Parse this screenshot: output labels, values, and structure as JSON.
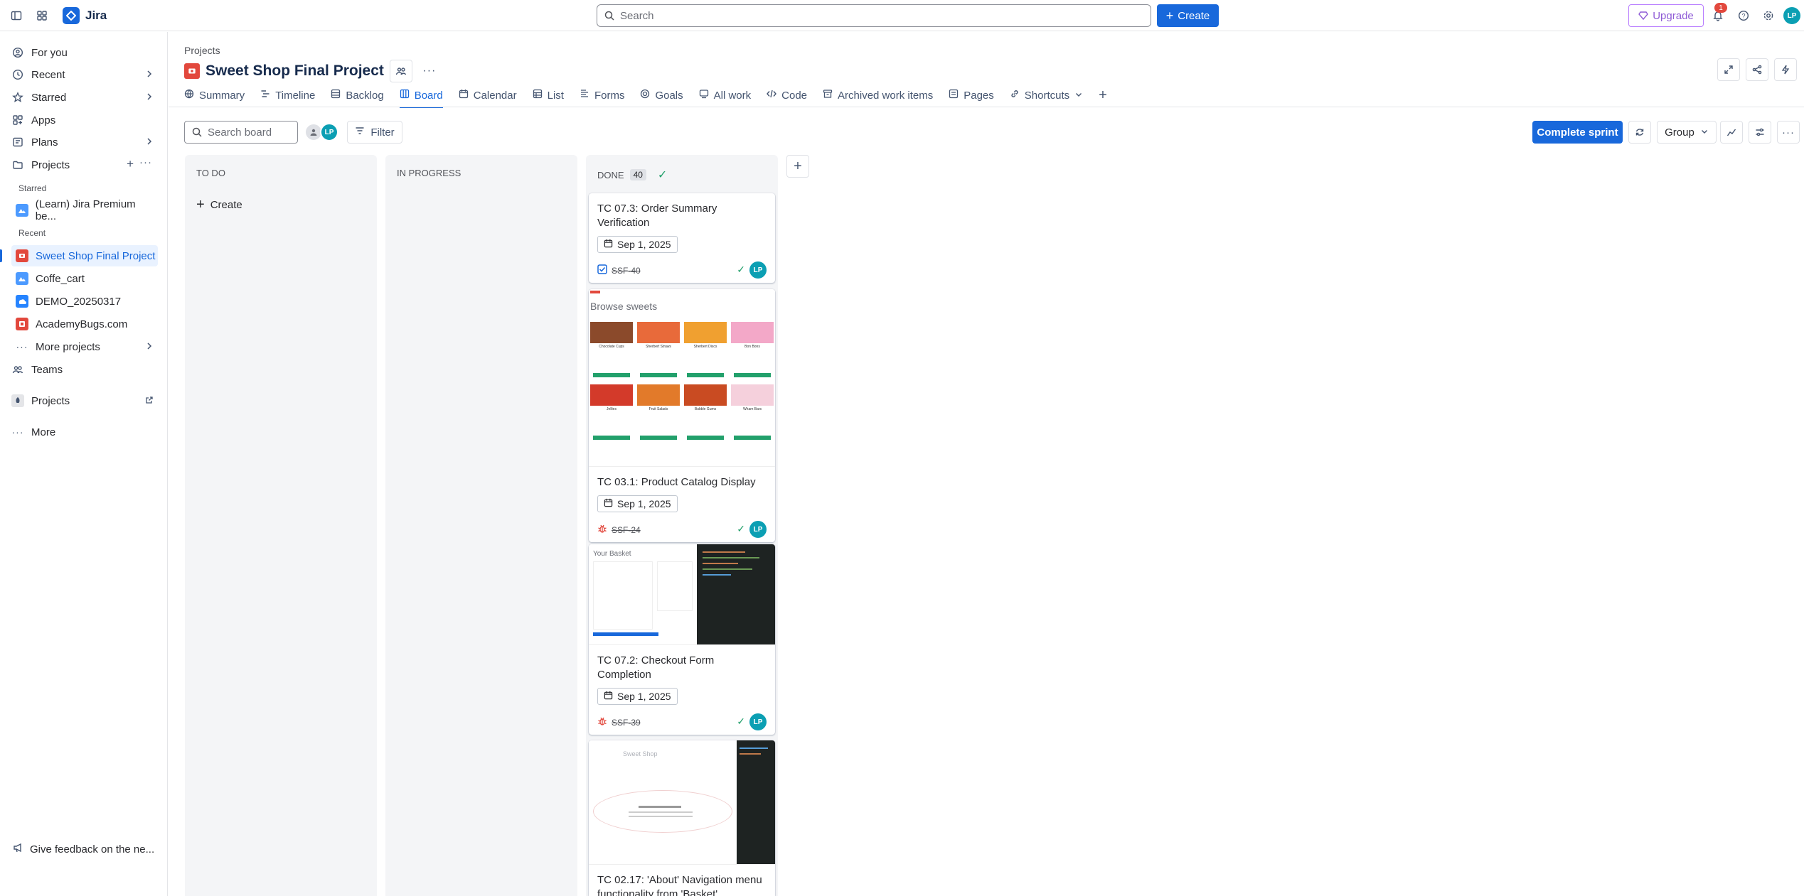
{
  "app": {
    "name": "Jira"
  },
  "topbar": {
    "search_placeholder": "Search",
    "create_label": "Create",
    "upgrade_label": "Upgrade",
    "notifications_count": "1",
    "user_initials": "LP"
  },
  "sidebar": {
    "for_you": "For you",
    "recent": "Recent",
    "starred": "Starred",
    "apps": "Apps",
    "plans": "Plans",
    "projects": "Projects",
    "starred_section": "Starred",
    "starred_project": "(Learn) Jira Premium be...",
    "recent_section": "Recent",
    "recent_projects": [
      "Sweet Shop Final Project",
      "Coffe_cart",
      "DEMO_20250317",
      "AcademyBugs.com"
    ],
    "more_projects": "More projects",
    "teams": "Teams",
    "projects_app": "Projects",
    "more": "More",
    "feedback": "Give feedback on the ne..."
  },
  "breadcrumb": "Projects",
  "project_title": "Sweet Shop Final Project",
  "tabs": [
    "Summary",
    "Timeline",
    "Backlog",
    "Board",
    "Calendar",
    "List",
    "Forms",
    "Goals",
    "All work",
    "Code",
    "Archived work items",
    "Pages",
    "Shortcuts"
  ],
  "active_tab": "Board",
  "toolbar": {
    "search_placeholder": "Search board",
    "filter_label": "Filter",
    "complete_sprint_label": "Complete sprint",
    "group_label": "Group",
    "avatar_initials": "LP"
  },
  "columns": {
    "todo": {
      "title": "TO DO",
      "create_label": "Create"
    },
    "in_progress": {
      "title": "IN PROGRESS"
    },
    "done": {
      "title": "DONE",
      "count": "40"
    }
  },
  "cards": [
    {
      "title": "TC 07.3: Order Summary Verification",
      "date": "Sep 1, 2025",
      "key": "SSF-40",
      "type": "task",
      "assignee": "LP"
    },
    {
      "title": "TC 03.1: Product Catalog Display",
      "date": "Sep 1, 2025",
      "key": "SSF-24",
      "type": "bug",
      "assignee": "LP",
      "cover_heading": "Browse sweets",
      "cover_products": [
        "Chocolate Cups",
        "Sherbert Straws",
        "Sherbert Discs",
        "Bon Bons",
        "Jellies",
        "Fruit Salads",
        "Bubble Gums",
        "Wham Bars"
      ]
    },
    {
      "title": "TC 07.2: Checkout Form Completion",
      "date": "Sep 1, 2025",
      "key": "SSF-39",
      "type": "bug",
      "assignee": "LP",
      "cover_heading": "Your Basket"
    },
    {
      "title": "TC 02.17: 'About' Navigation menu functionality from 'Basket'",
      "cover_heading": "Sweet Shop"
    }
  ],
  "colors": {
    "accent": "#1868db",
    "avatar": "#0b9fb3",
    "done_green": "#22a06b",
    "bug_red": "#e2483d",
    "upgrade_purple": "#8f5cd6"
  }
}
